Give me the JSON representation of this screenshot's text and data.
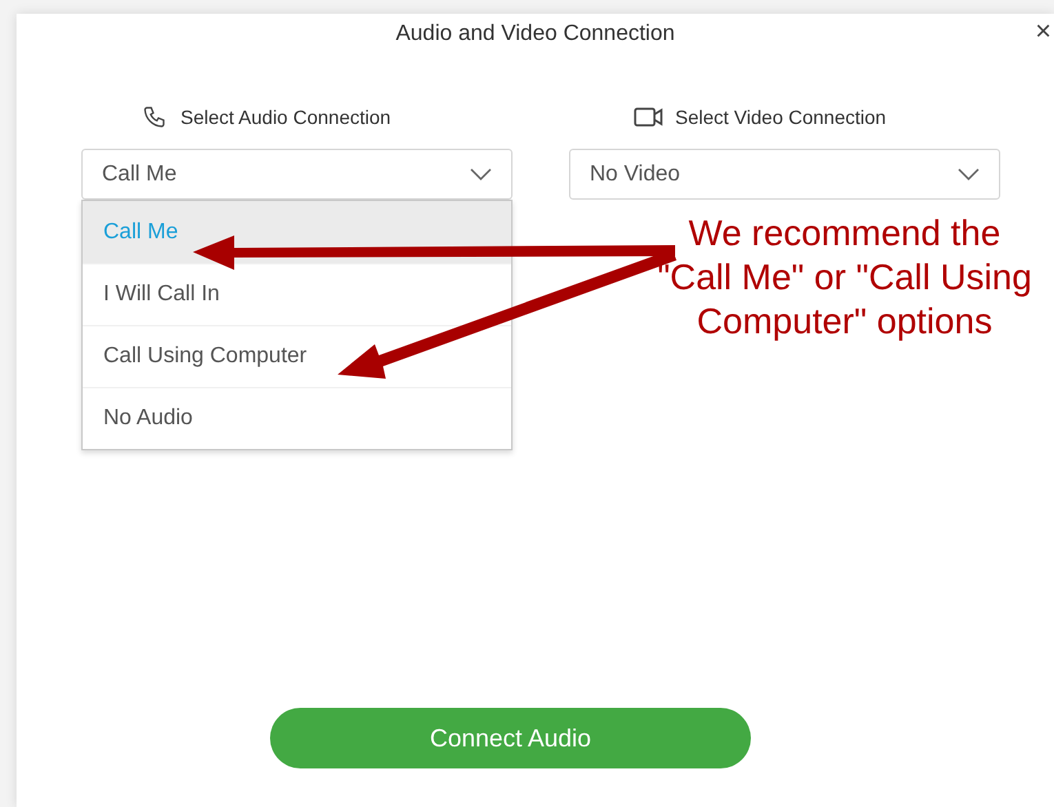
{
  "window": {
    "title": "Audio and Video Connection",
    "close": "×"
  },
  "audio": {
    "label": "Select Audio Connection",
    "value": "Call Me",
    "expanded": true,
    "options": [
      {
        "label": "Call Me",
        "selected": true
      },
      {
        "label": "I Will Call In",
        "selected": false
      },
      {
        "label": "Call Using Computer",
        "selected": false
      },
      {
        "label": "No Audio",
        "selected": false
      }
    ]
  },
  "video": {
    "label": "Select Video Connection",
    "value": "No Video"
  },
  "annotation": {
    "text": "We recommend the \"Call Me\" or \"Call Using Computer\" options"
  },
  "connect_button": "Connect Audio"
}
